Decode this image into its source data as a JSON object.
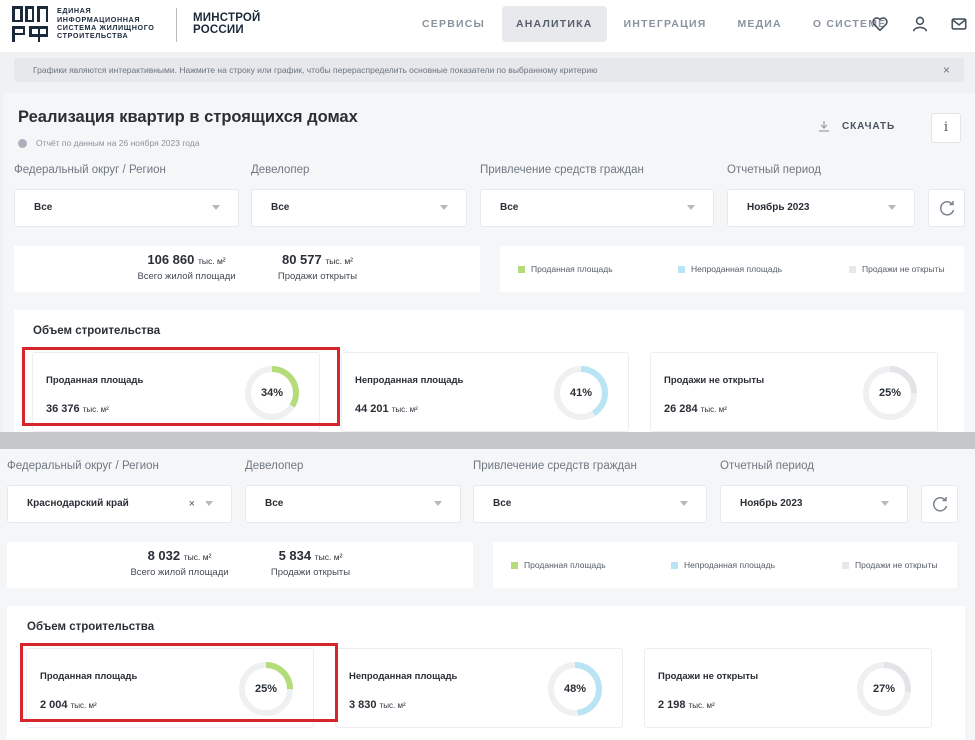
{
  "header": {
    "logo_text": "ЕДИНАЯ ИНФОРМАЦИОННАЯ СИСТЕМА ЖИЛИЩНОГО СТРОИТЕЛЬСТВА",
    "logo_mark": "ДОМ РФ",
    "ministry": "МИНСТРОЙ РОССИИ",
    "nav": [
      {
        "label": "СЕРВИСЫ",
        "active": false
      },
      {
        "label": "АНАЛИТИКА",
        "active": true
      },
      {
        "label": "ИНТЕГРАЦИЯ",
        "active": false
      },
      {
        "label": "МЕДИА",
        "active": false
      },
      {
        "label": "О СИСТЕМЕ",
        "active": false
      }
    ],
    "icons": [
      "heart-icon",
      "user-icon",
      "mail-icon"
    ]
  },
  "banner": {
    "text": "Графики являются интерактивными. Нажмите на строку или график, чтобы перераспределить основные показатели по выбранному критерию",
    "close": "×"
  },
  "page": {
    "title": "Реализация квартир в строящихся домах",
    "report_date": "Отчёт по данным на 26 ноября 2023 года",
    "download_label": "СКАЧАТЬ",
    "info_label": "i"
  },
  "upper": {
    "filters": {
      "region_label": "Федеральный округ / Регион",
      "region_value": "Все",
      "developer_label": "Девелопер",
      "developer_value": "Все",
      "funds_label": "Привлечение средств граждан",
      "funds_value": "Все",
      "period_label": "Отчетный период",
      "period_value": "Ноябрь 2023"
    },
    "totals": {
      "total_value": "106 860",
      "total_unit": "тыс. м²",
      "total_caption": "Всего жилой площади",
      "open_value": "80 577",
      "open_unit": "тыс. м²",
      "open_caption": "Продажи открыты"
    },
    "volume": {
      "title": "Объем строительства",
      "metrics": [
        {
          "name": "Проданная площадь",
          "value": "36 376",
          "unit": "тыс. м²",
          "percent_label": "34%",
          "fraction": 0.34
        },
        {
          "name": "Непроданная площадь",
          "value": "44 201",
          "unit": "тыс. м²",
          "percent_label": "41%",
          "fraction": 0.41
        },
        {
          "name": "Продажи не открыты",
          "value": "26 284",
          "unit": "тыс. м²",
          "percent_label": "25%",
          "fraction": 0.25
        }
      ]
    }
  },
  "lower": {
    "filters": {
      "region_label": "Федеральный округ / Регион",
      "region_value": "Краснодарский край",
      "region_clear": "×",
      "developer_label": "Девелопер",
      "developer_value": "Все",
      "funds_label": "Привлечение средств граждан",
      "funds_value": "Все",
      "period_label": "Отчетный период",
      "period_value": "Ноябрь 2023"
    },
    "totals": {
      "total_value": "8 032",
      "total_unit": "тыс. м²",
      "total_caption": "Всего жилой площади",
      "open_value": "5 834",
      "open_unit": "тыс. м²",
      "open_caption": "Продажи открыты"
    },
    "volume": {
      "title": "Объем строительства",
      "metrics": [
        {
          "name": "Проданная площадь",
          "value": "2 004",
          "unit": "тыс. м²",
          "percent_label": "25%",
          "fraction": 0.25
        },
        {
          "name": "Непроданная площадь",
          "value": "3 830",
          "unit": "тыс. м²",
          "percent_label": "48%",
          "fraction": 0.48
        },
        {
          "name": "Продажи не открыты",
          "value": "2 198",
          "unit": "тыс. м²",
          "percent_label": "27%",
          "fraction": 0.27
        }
      ]
    }
  },
  "legend": [
    {
      "label": "Проданная площадь",
      "color": "#b5dc7a"
    },
    {
      "label": "Непроданная площадь",
      "color": "#b9e4f3"
    },
    {
      "label": "Продажи не открыты",
      "color": "#e6e8ea"
    }
  ],
  "colors": {
    "sold": "#b5dc7a",
    "unsold": "#b9e4f3",
    "not_open": "#e6e8ea",
    "highlight": "#d7262b"
  }
}
